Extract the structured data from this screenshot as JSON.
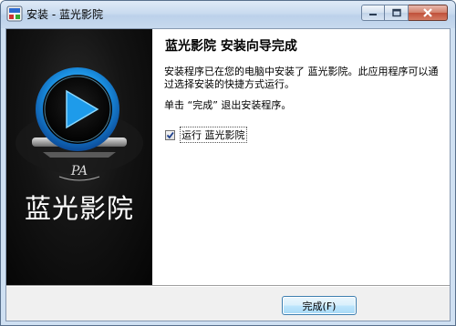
{
  "window": {
    "title": "安装 - 蓝光影院",
    "controls": {
      "minimize": "minimize-icon",
      "maximize": "maximize-icon",
      "close": "close-icon"
    }
  },
  "sidebar": {
    "app_name": "蓝光影院",
    "logo_icon": "play-icon",
    "emblem_text": "PA"
  },
  "content": {
    "heading": "蓝光影院 安装向导完成",
    "paragraph1": "安装程序已在您的电脑中安装了 蓝光影院。此应用程序可以通过选择安装的快捷方式运行。",
    "paragraph2": "单击 “完成” 退出安装程序。",
    "launch_checkbox": {
      "label": "运行 蓝光影院",
      "checked": true
    }
  },
  "footer": {
    "finish_button": "完成(F)"
  },
  "colors": {
    "accent": "#1a8fe0",
    "sidebar_bg": "#0a0a0a",
    "frame": "#cfe0f2"
  }
}
